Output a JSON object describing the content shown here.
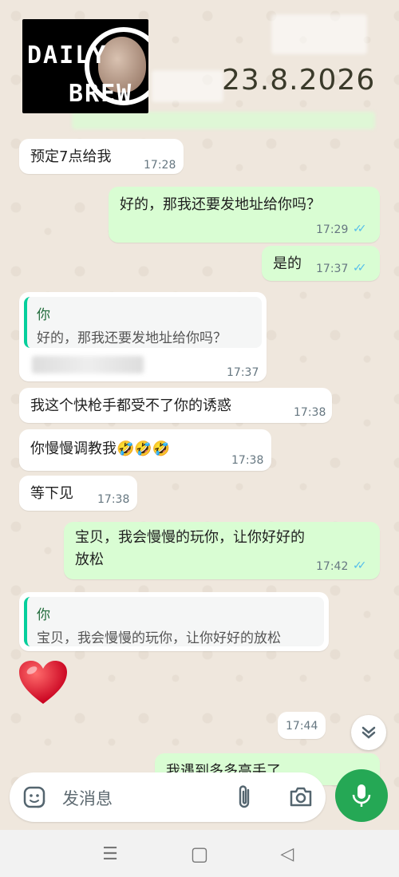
{
  "header": {
    "logo_line1": "DAILY",
    "logo_line2": "BREW",
    "date": "23.8.2026"
  },
  "messages": [
    {
      "text": "预定7点给我",
      "time": "17:28",
      "dir": "in"
    },
    {
      "text": "好的，那我还要发地址给你吗？",
      "time": "17:29",
      "dir": "out",
      "ticks": "✓✓"
    },
    {
      "text": "是的",
      "time": "17:37",
      "dir": "out",
      "ticks": "✓✓"
    },
    {
      "quote_name": "你",
      "quote_text": "好的，那我还要发地址给你吗？",
      "time": "17:37",
      "dir": "in"
    },
    {
      "text": "我这个快枪手都受不了你的诱惑",
      "time": "17:38",
      "dir": "in"
    },
    {
      "text": "你慢慢调教我🤣🤣🤣",
      "time": "17:38",
      "dir": "in"
    },
    {
      "text": "等下见",
      "time": "17:38",
      "dir": "in"
    },
    {
      "text_line1": "宝贝，我会慢慢的玩你，让你好好的",
      "text_line2": "放松",
      "time": "17:42",
      "dir": "out",
      "ticks": "✓✓"
    },
    {
      "quote_name": "你",
      "quote_text": "宝贝，我会慢慢的玩你，让你好好的放松",
      "dir": "in"
    },
    {
      "emoji": "heart",
      "time": "17:44",
      "dir": "in"
    },
    {
      "text": "我遇到多多高手了",
      "dir": "out"
    }
  ],
  "composer": {
    "placeholder": "发消息"
  },
  "icons": {
    "sticker": "sticker-icon",
    "attach": "paperclip-icon",
    "camera": "camera-icon",
    "mic": "mic-icon",
    "scroll": "chevron-double-down-icon"
  },
  "nav": {
    "menu": "☰",
    "home": "▢",
    "back": "◁"
  },
  "colors": {
    "outgoing_bubble": "#d9fdd3",
    "incoming_bubble": "#ffffff",
    "accent_green": "#25a855",
    "tick_blue": "#53bdeb"
  }
}
